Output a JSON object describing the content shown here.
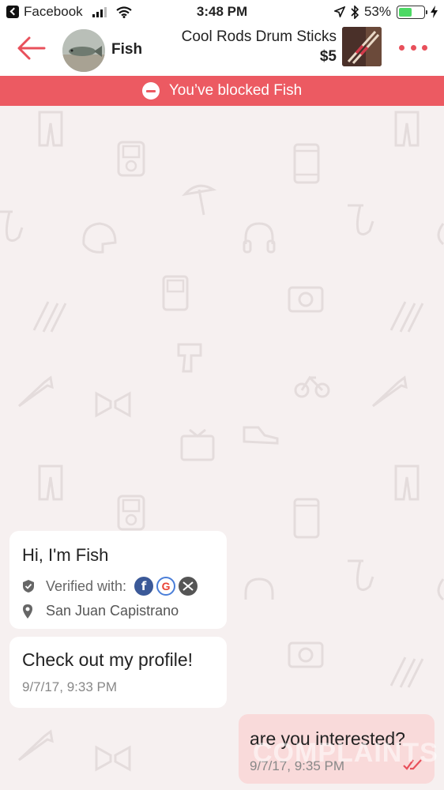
{
  "status_bar": {
    "back_app": "Facebook",
    "time": "3:48 PM",
    "battery_percent": "53%",
    "battery_level": 0.53,
    "icons": [
      "back-chevron-icon",
      "signal-icon",
      "wifi-icon",
      "location-arrow-icon",
      "bluetooth-icon",
      "battery-icon",
      "charging-bolt-icon"
    ]
  },
  "header": {
    "seller_name": "Fish",
    "item_title": "Cool Rods Drum Sticks",
    "item_price": "$5",
    "icons": [
      "back-arrow-icon",
      "more-dots-icon"
    ]
  },
  "banner": {
    "text": "You’ve blocked Fish",
    "icon": "block-icon"
  },
  "profile_card": {
    "greeting": "Hi, I'm Fish",
    "verified_label": "Verified with:",
    "verified_services": [
      "facebook-icon",
      "google-icon",
      "email-icon"
    ],
    "location": "San Juan Capistrano"
  },
  "messages": [
    {
      "text": "Check out my profile!",
      "time": "9/7/17, 9:33 PM",
      "direction": "received"
    },
    {
      "text": "are you interested?",
      "time": "9/7/17, 9:35 PM",
      "direction": "sent",
      "status_icon": "read-checkmarks-icon"
    }
  ],
  "watermark": "COMPLAINTS",
  "colors": {
    "accent": "#ec5a62",
    "background": "#f6f0f0",
    "sent_bubble": "#f9dada",
    "facebook": "#3b5998"
  }
}
